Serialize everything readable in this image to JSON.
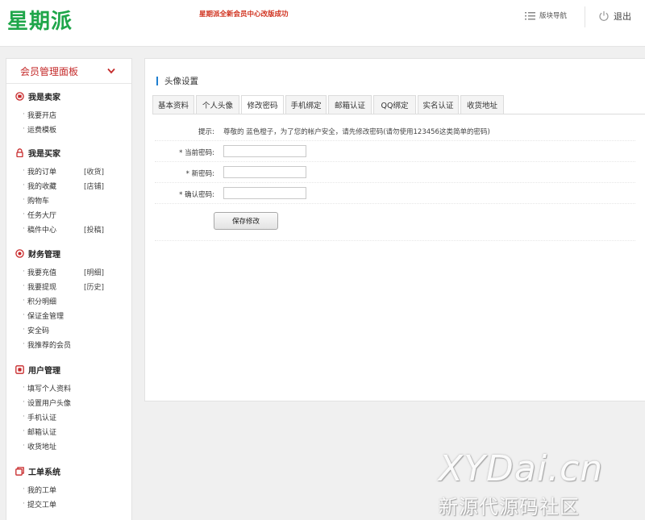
{
  "header": {
    "logo": "星期派",
    "notice": "星期派全新会员中心改版成功",
    "nav_label": "版块导航",
    "logout_label": "退出"
  },
  "sidebar": {
    "title": "会员管理面板",
    "groups": [
      {
        "title": "我是卖家",
        "icon": "seller-icon",
        "items": [
          {
            "label": "我要开店",
            "extra": ""
          },
          {
            "label": "运费模板",
            "extra": ""
          }
        ]
      },
      {
        "title": "我是买家",
        "icon": "lock-icon",
        "items": [
          {
            "label": "我的订单",
            "extra": "[收货]"
          },
          {
            "label": "我的收藏",
            "extra": "[店铺]"
          },
          {
            "label": "购物车",
            "extra": ""
          },
          {
            "label": "任务大厅",
            "extra": ""
          },
          {
            "label": "稿件中心",
            "extra": "[投稿]"
          }
        ]
      },
      {
        "title": "财务管理",
        "icon": "finance-icon",
        "items": [
          {
            "label": "我要充值",
            "extra": "[明细]"
          },
          {
            "label": "我要提现",
            "extra": "[历史]"
          },
          {
            "label": "积分明细",
            "extra": ""
          },
          {
            "label": "保证金管理",
            "extra": ""
          },
          {
            "label": "安全码",
            "extra": ""
          },
          {
            "label": "我推荐的会员",
            "extra": ""
          }
        ]
      },
      {
        "title": "用户管理",
        "icon": "user-icon",
        "items": [
          {
            "label": "填写个人资料",
            "extra": ""
          },
          {
            "label": "设置用户头像",
            "extra": ""
          },
          {
            "label": "手机认证",
            "extra": ""
          },
          {
            "label": "邮箱认证",
            "extra": ""
          },
          {
            "label": "收货地址",
            "extra": ""
          }
        ]
      },
      {
        "title": "工单系统",
        "icon": "ticket-icon",
        "items": [
          {
            "label": "我的工单",
            "extra": ""
          },
          {
            "label": "提交工单",
            "extra": ""
          }
        ]
      }
    ]
  },
  "main": {
    "title": "头像设置",
    "tabs": [
      "基本资料",
      "个人头像",
      "修改密码",
      "手机绑定",
      "邮箱认证",
      "QQ绑定",
      "实名认证",
      "收货地址"
    ],
    "active_tab": 2,
    "tip_label": "提示:",
    "tip_text": "尊敬的 蓝色橙子，为了您的帐户安全，请先修改密码(请勿使用123456这类简单的密码)",
    "fields": [
      {
        "label": "* 当前密码:",
        "value": ""
      },
      {
        "label": "* 新密码:",
        "value": ""
      },
      {
        "label": "* 确认密码:",
        "value": ""
      }
    ],
    "save_label": "保存修改"
  },
  "watermark": {
    "line1": "XYDai.cn",
    "line2": "新源代源码社区"
  },
  "colors": {
    "logo": "#1fa64a",
    "notice": "#d0311e",
    "sidebar_title": "#c42a2a",
    "title_bar": "#1e7fd0",
    "icon_red": "#c8282a"
  }
}
